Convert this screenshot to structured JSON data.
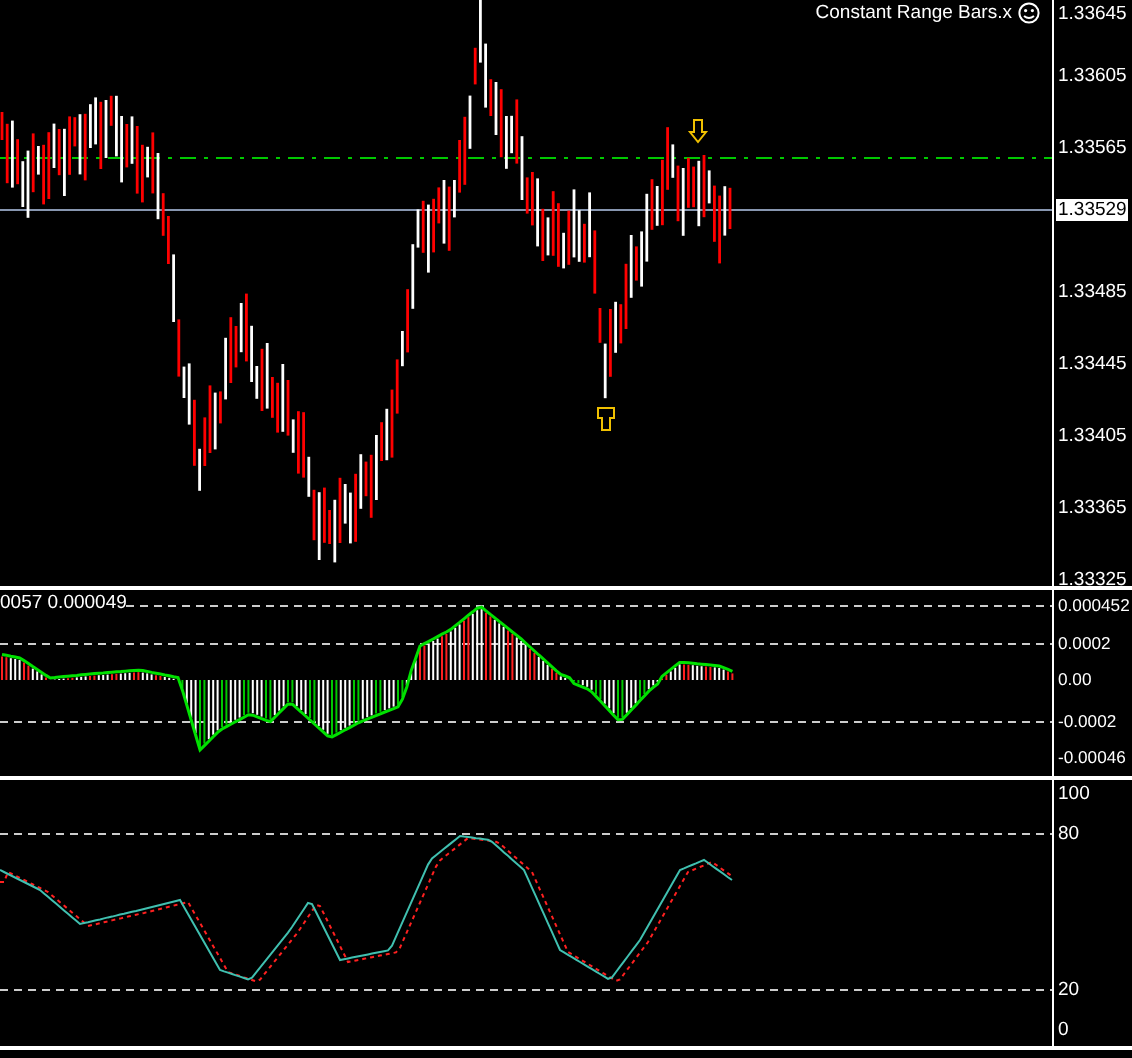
{
  "chart_title": "Constant Range Bars.x",
  "price_axis": {
    "labels": [
      "1.33645",
      "1.33605",
      "1.33565",
      "1.33485",
      "1.33445",
      "1.33405",
      "1.33365",
      "1.33325"
    ],
    "current_price": "1.33529"
  },
  "macd": {
    "label": "0057 0.000049",
    "axis_labels": [
      "0.000452",
      "0.0002",
      "0.00",
      "-0.0002",
      "-0.00046"
    ]
  },
  "stochastic": {
    "axis_labels": [
      "100",
      "80",
      "20",
      "0"
    ]
  }
}
